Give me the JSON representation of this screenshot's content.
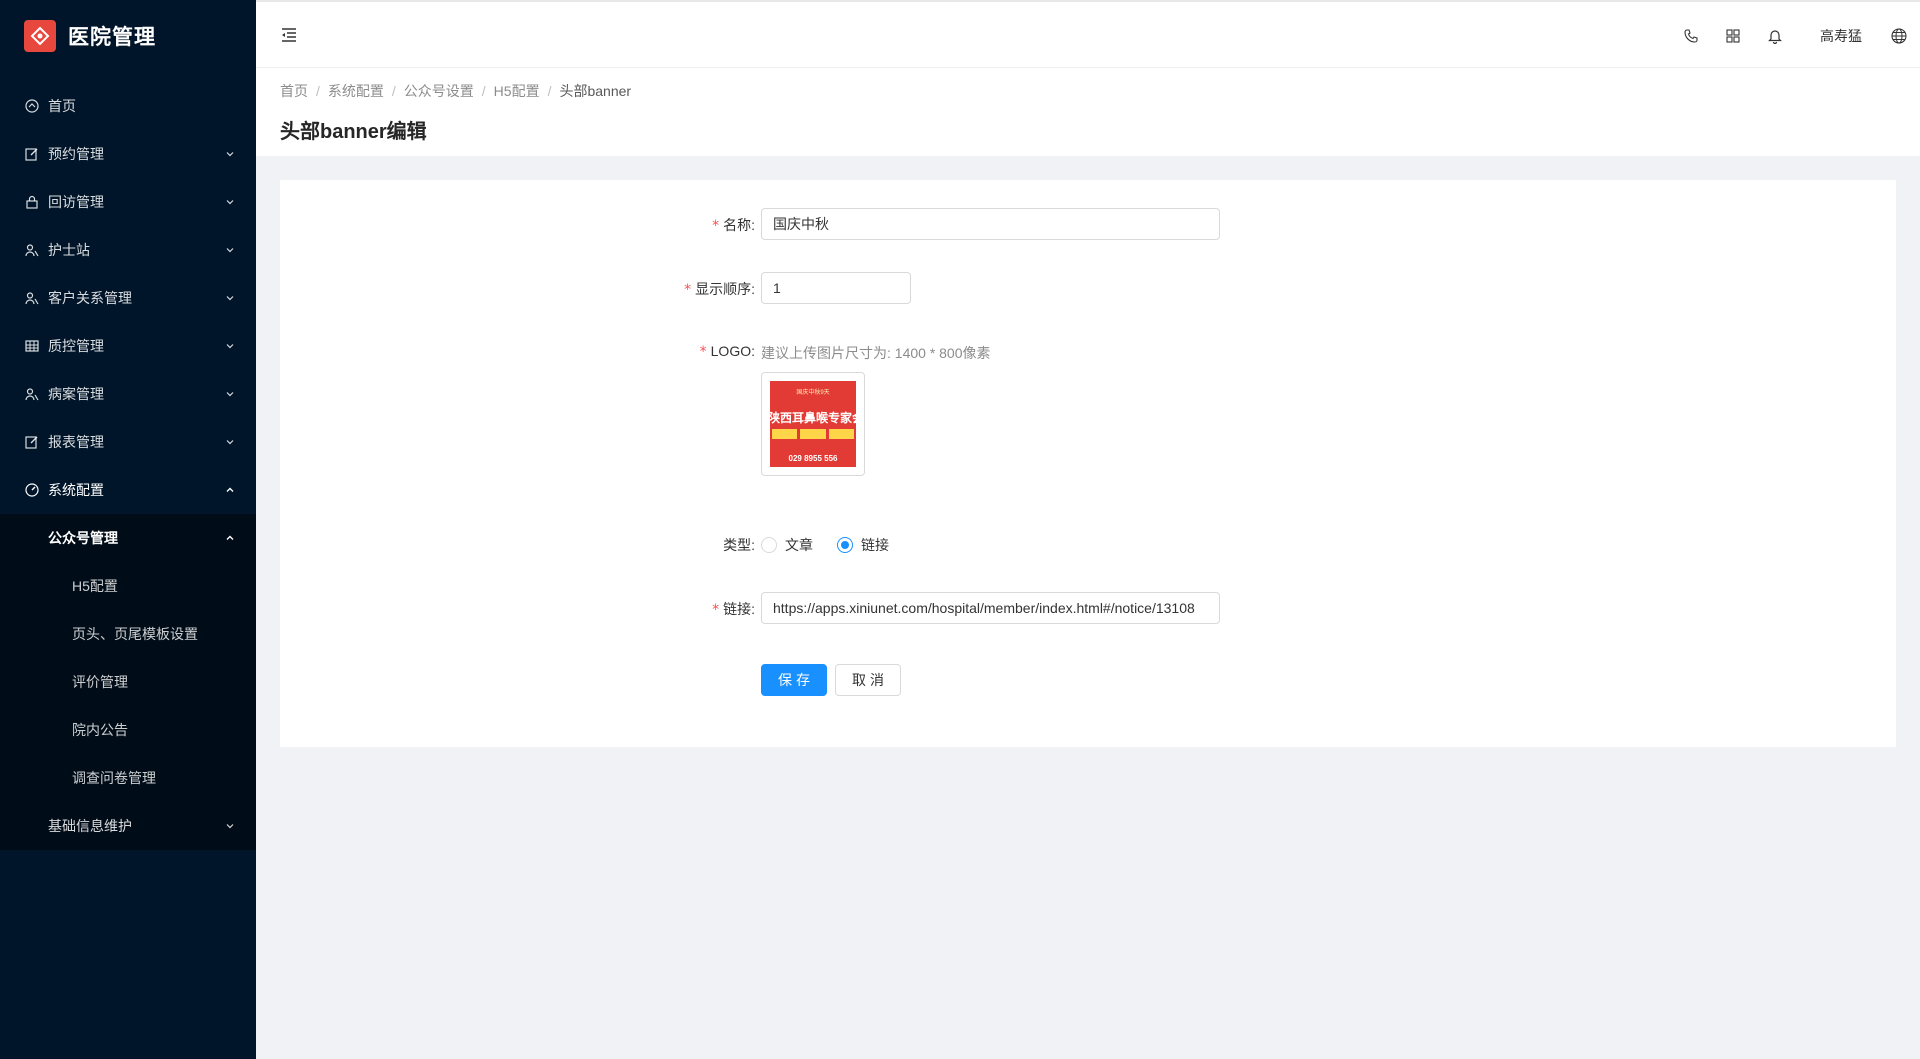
{
  "app": {
    "title": "医院管理"
  },
  "sidebar": {
    "items": [
      {
        "label": "首页",
        "icon": "dashboard-icon"
      },
      {
        "label": "预约管理",
        "icon": "edit-icon"
      },
      {
        "label": "回访管理",
        "icon": "lock-icon"
      },
      {
        "label": "护士站",
        "icon": "team-icon"
      },
      {
        "label": "客户关系管理",
        "icon": "team-icon"
      },
      {
        "label": "质控管理",
        "icon": "table-icon"
      },
      {
        "label": "病案管理",
        "icon": "team-icon"
      },
      {
        "label": "报表管理",
        "icon": "edit-icon"
      },
      {
        "label": "系统配置",
        "icon": "dashboard-icon"
      }
    ],
    "system_sub": {
      "label": "公众号管理",
      "children": [
        "H5配置",
        "页头、页尾模板设置",
        "评价管理",
        "院内公告",
        "调查问卷管理"
      ]
    },
    "basic_info": {
      "label": "基础信息维护"
    }
  },
  "header": {
    "user_name": "高寿猛",
    "icons": [
      "phone-icon",
      "appstore-icon",
      "bell-icon",
      "globe-icon"
    ]
  },
  "breadcrumb": {
    "items": [
      "首页",
      "系统配置",
      "公众号设置",
      "H5配置"
    ],
    "current": "头部banner",
    "separator": "/"
  },
  "page": {
    "title": "头部banner编辑"
  },
  "form": {
    "required_mark": "*",
    "name": {
      "label": "名称:",
      "value": "国庆中秋"
    },
    "order": {
      "label": "显示顺序:",
      "value": "1"
    },
    "logo": {
      "label": "LOGO:",
      "hint": "建议上传图片尺寸为: 1400 * 800像素",
      "img_line1": "国庆中秋9天",
      "img_line2": "陕西耳鼻喉专家会",
      "img_line3": "029 8955 556"
    },
    "type": {
      "label": "类型:",
      "options": [
        "文章",
        "链接"
      ],
      "selected": "链接"
    },
    "link": {
      "label": "链接:",
      "value": "https://apps.xiniunet.com/hospital/member/index.html#/notice/13108"
    },
    "save_label": "保存",
    "cancel_label": "取消"
  },
  "colors": {
    "sidebar_bg": "#001529",
    "primary": "#1890ff",
    "logo_red": "#e8473e",
    "required": "#ff4d4f"
  }
}
